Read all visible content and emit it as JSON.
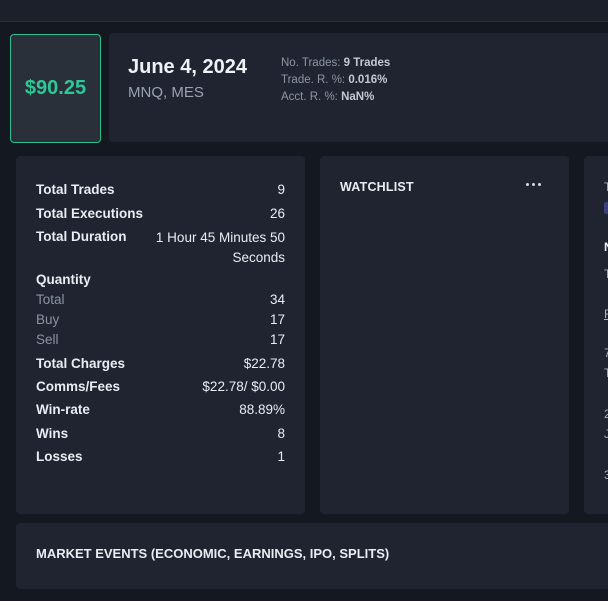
{
  "header": {
    "pnl": "$90.25",
    "date": "June 4, 2024",
    "symbols": "MNQ, MES",
    "stats": [
      {
        "label": "No. Trades:",
        "value": "9 Trades"
      },
      {
        "label": "Trade. R. %:",
        "value": "0.016%"
      },
      {
        "label": "Acct. R. %:",
        "value": "NaN%"
      }
    ]
  },
  "summary": {
    "total_trades_label": "Total Trades",
    "total_trades": "9",
    "total_executions_label": "Total Executions",
    "total_executions": "26",
    "total_duration_label": "Total Duration",
    "total_duration": "1 Hour 45 Minutes 50 Seconds",
    "quantity_label": "Quantity",
    "qty_total_label": "Total",
    "qty_total": "34",
    "qty_buy_label": "Buy",
    "qty_buy": "17",
    "qty_sell_label": "Sell",
    "qty_sell": "17",
    "total_charges_label": "Total Charges",
    "total_charges": "$22.78",
    "comms_fees_label": "Comms/Fees",
    "comms_fees": "$22.78/ $0.00",
    "win_rate_label": "Win-rate",
    "win_rate": "88.89%",
    "wins_label": "Wins",
    "wins": "8",
    "losses_label": "Losses",
    "losses": "1"
  },
  "watchlist": {
    "title": "WATCHLIST"
  },
  "events": {
    "title": "MARKET EVENTS (ECONOMIC, EARNINGS, IPO, SPLITS)"
  },
  "third_panel": {
    "fragments": [
      "T",
      "N",
      "T",
      "F",
      "7",
      "T",
      "2",
      "J",
      "3"
    ]
  },
  "colors": {
    "accent": "#2ec795",
    "card": "#1f2430",
    "background": "#141821"
  }
}
